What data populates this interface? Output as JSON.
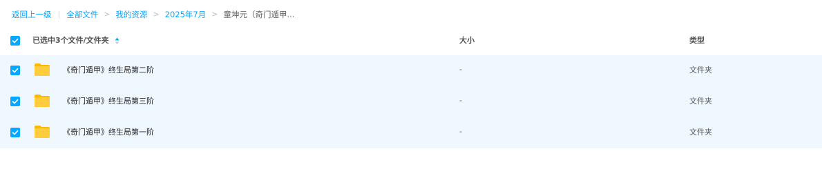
{
  "breadcrumb": {
    "back": "返回上一级",
    "divider": "|",
    "items": [
      "全部文件",
      "我的资源",
      "2025年7月"
    ],
    "current": "童坤元（奇门遁甲..."
  },
  "table": {
    "header": {
      "name": "已选中3个文件/文件夹",
      "size": "大小",
      "type": "类型",
      "all_checked": true,
      "sort_icon": "sort-ascending-icon"
    },
    "rows": [
      {
        "name": "《奇门遁甲》终生局第二阶",
        "size": "-",
        "type": "文件夹",
        "checked": true,
        "icon": "folder-icon"
      },
      {
        "name": "《奇门遁甲》终生局第三阶",
        "size": "-",
        "type": "文件夹",
        "checked": true,
        "icon": "folder-icon"
      },
      {
        "name": "《奇门遁甲》终生局第一阶",
        "size": "-",
        "type": "文件夹",
        "checked": true,
        "icon": "folder-icon"
      }
    ]
  },
  "colors": {
    "accent": "#06a7ff",
    "selected_row": "#f0f8ff",
    "folder": "#ffc42b"
  }
}
